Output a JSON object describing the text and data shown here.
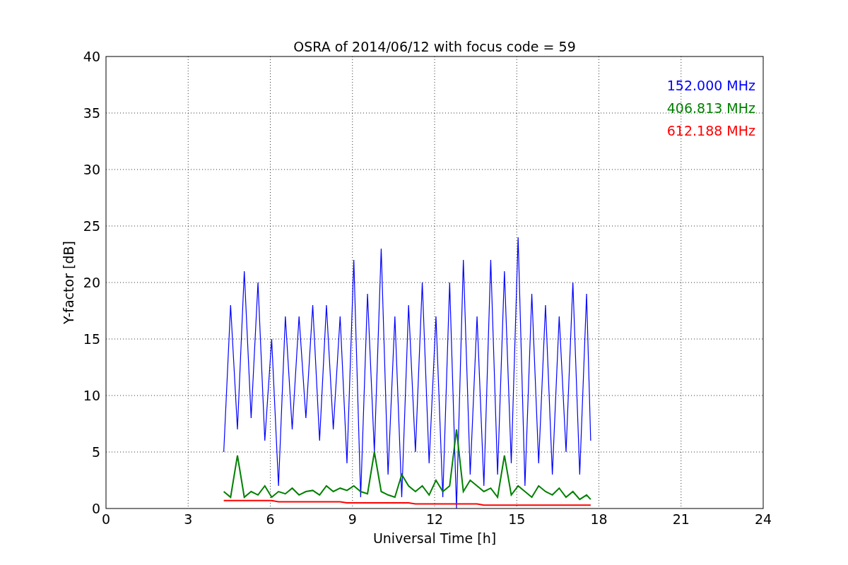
{
  "chart_data": {
    "type": "line",
    "title": "OSRA of 2014/06/12 with focus code = 59",
    "xlabel": "Universal Time [h]",
    "ylabel": "Y-factor [dB]",
    "x": [
      4.3,
      4.55,
      4.8,
      5.05,
      5.3,
      5.55,
      5.8,
      6.05,
      6.3,
      6.55,
      6.8,
      7.05,
      7.3,
      7.55,
      7.8,
      8.05,
      8.3,
      8.55,
      8.8,
      9.05,
      9.3,
      9.55,
      9.8,
      10.05,
      10.3,
      10.55,
      10.8,
      11.05,
      11.3,
      11.55,
      11.8,
      12.05,
      12.3,
      12.55,
      12.8,
      13.05,
      13.3,
      13.55,
      13.8,
      14.05,
      14.3,
      14.55,
      14.8,
      15.05,
      15.3,
      15.55,
      15.8,
      16.05,
      16.3,
      16.55,
      16.8,
      17.05,
      17.3,
      17.55,
      17.7
    ],
    "series": [
      {
        "name": "152.000 MHz",
        "color": "#0000ff",
        "values": [
          5,
          18,
          7,
          21,
          8,
          20,
          6,
          15,
          2,
          17,
          7,
          17,
          8,
          18,
          6,
          18,
          7,
          17,
          4,
          22,
          1,
          19,
          5,
          23,
          3,
          17,
          1,
          18,
          5,
          20,
          4,
          17,
          1,
          20,
          0,
          22,
          3,
          17,
          2,
          22,
          3,
          21,
          4,
          24,
          2,
          19,
          4,
          18,
          3,
          17,
          5,
          20,
          3,
          19,
          6
        ]
      },
      {
        "name": "406.813 MHz",
        "color": "#008000",
        "values": [
          1.5,
          1,
          4.7,
          1,
          1.5,
          1.2,
          2,
          1,
          1.5,
          1.3,
          1.8,
          1.2,
          1.5,
          1.6,
          1.2,
          2,
          1.5,
          1.8,
          1.6,
          2,
          1.5,
          1.3,
          5,
          1.5,
          1.2,
          1,
          3,
          2,
          1.5,
          2,
          1.2,
          2.5,
          1.5,
          2,
          7,
          1.5,
          2.5,
          2,
          1.5,
          1.8,
          1,
          4.7,
          1.2,
          2,
          1.5,
          1,
          2,
          1.5,
          1.2,
          1.8,
          1,
          1.5,
          0.8,
          1.2,
          0.8
        ]
      },
      {
        "name": "612.188 MHz",
        "color": "#ff0000",
        "values": [
          0.7,
          0.7,
          0.7,
          0.7,
          0.7,
          0.7,
          0.7,
          0.7,
          0.6,
          0.6,
          0.6,
          0.6,
          0.6,
          0.6,
          0.6,
          0.6,
          0.6,
          0.6,
          0.5,
          0.5,
          0.5,
          0.5,
          0.5,
          0.5,
          0.5,
          0.5,
          0.5,
          0.5,
          0.4,
          0.4,
          0.4,
          0.4,
          0.4,
          0.4,
          0.4,
          0.4,
          0.4,
          0.4,
          0.3,
          0.3,
          0.3,
          0.3,
          0.3,
          0.3,
          0.3,
          0.3,
          0.3,
          0.3,
          0.3,
          0.3,
          0.3,
          0.3,
          0.3,
          0.3,
          0.3
        ]
      }
    ],
    "xlim": [
      0,
      24
    ],
    "ylim": [
      0,
      40
    ],
    "xticks": [
      0,
      3,
      6,
      9,
      12,
      15,
      18,
      21,
      24
    ],
    "yticks": [
      0,
      5,
      10,
      15,
      20,
      25,
      30,
      35,
      40
    ],
    "grid": true
  }
}
